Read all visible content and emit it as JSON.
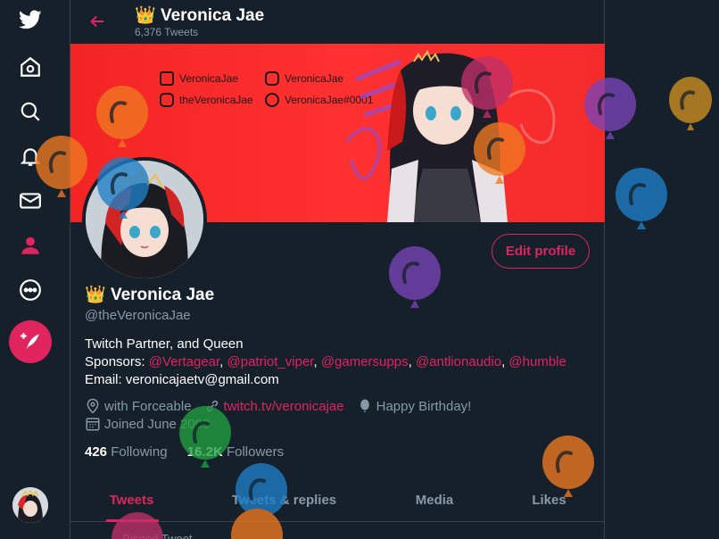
{
  "top": {
    "name": "Veronica Jae",
    "tweet_count": "6,376 Tweets"
  },
  "banner": {
    "twitch": "VeronicaJae",
    "youtube": "VeronicaJae",
    "instagram": "theVeronicaJae",
    "discord": "VeronicaJae#0001"
  },
  "profile": {
    "crown": "👑",
    "name": "Veronica Jae",
    "handle": "@theVeronicaJae",
    "bio_line1": "Twitch Partner, and Queen",
    "sponsors_label": "Sponsors:",
    "sponsors": [
      "@Vertagear",
      "@patriot_viper",
      "@gamersupps",
      "@antlionaudio",
      "@humble"
    ],
    "email_line": "Email: veronicajaetv@gmail.com",
    "location": "with Forceable",
    "website": "twitch.tv/veronicajae",
    "birthday": "Happy Birthday!",
    "joined": "Joined June 2009",
    "following_count": "426",
    "following_label": "Following",
    "followers_count": "16.2K",
    "followers_label": "Followers",
    "edit_label": "Edit profile"
  },
  "tabs": [
    {
      "label": "Tweets",
      "active": true
    },
    {
      "label": "Tweets & replies",
      "active": false
    },
    {
      "label": "Media",
      "active": false
    },
    {
      "label": "Likes",
      "active": false
    }
  ],
  "pinned_label": "Pinned Tweet",
  "colors": {
    "background": "#15202b",
    "accent": "#e0245e",
    "muted": "#8899a6",
    "banner": "#f22424"
  },
  "icons": {
    "sidebar": [
      "twitter-logo-icon",
      "home-icon",
      "explore-icon",
      "notifications-icon",
      "messages-icon",
      "profile-icon",
      "more-icon"
    ]
  }
}
